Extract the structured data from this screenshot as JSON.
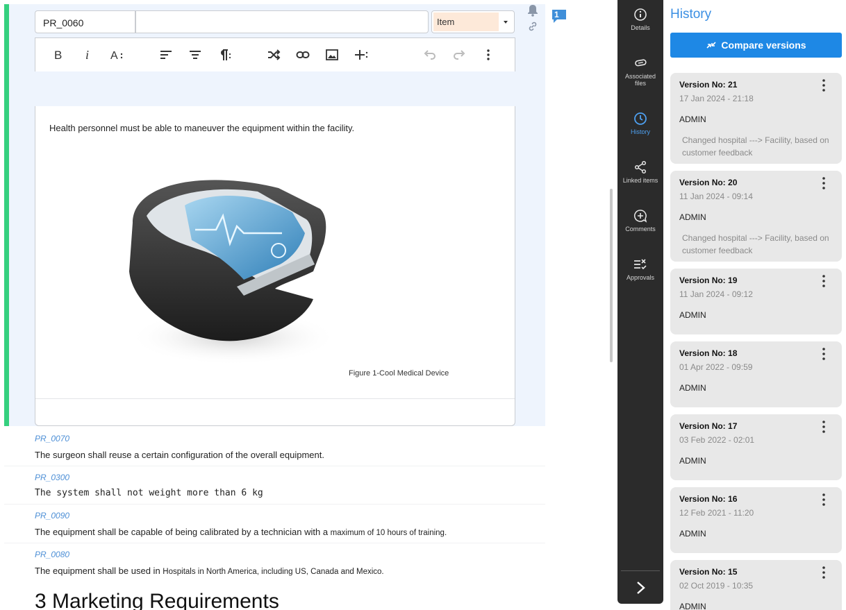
{
  "editor": {
    "item_id": "PR_0060",
    "item_title": "",
    "item_type": "Item",
    "comment_count": "1",
    "body_text": "Health personnel must be able to maneuver the equipment within the facility.",
    "figure_caption": "Figure 1-Cool Medical Device"
  },
  "requirements": [
    {
      "id": "PR_0070",
      "text": "The surgeon shall  reuse a certain configuration of the overall equipment."
    },
    {
      "id": "PR_0300",
      "text": "The system shall not weight more than 6 kg"
    },
    {
      "id": "PR_0090",
      "text": "The equipment shall be capable of being calibrated by a technician with a ",
      "text_small": "maximum of 10 hours of training."
    },
    {
      "id": "PR_0080",
      "text": "The equipment shall be used in ",
      "text_small": "Hospitals in North America, including US, Canada and Mexico."
    }
  ],
  "section_heading": "3  Marketing Requirements",
  "rail": {
    "details": "Details",
    "associated_files_1": "Associated",
    "associated_files_2": "files",
    "history": "History",
    "linked_items": "Linked items",
    "comments": "Comments",
    "approvals": "Approvals"
  },
  "history": {
    "title": "History",
    "compare_label": "Compare versions",
    "versions": [
      {
        "label": "Version No: 21",
        "date": "17 Jan 2024 - 21:18",
        "user": "ADMIN",
        "note": "Changed hospital ---> Facility, based on customer feedback"
      },
      {
        "label": "Version No: 20",
        "date": "11 Jan 2024 - 09:14",
        "user": "ADMIN",
        "note": "Changed hospital ---> Facility, based on customer feedback"
      },
      {
        "label": "Version No: 19",
        "date": "11 Jan 2024 - 09:12",
        "user": "ADMIN"
      },
      {
        "label": "Version No: 18",
        "date": "01 Apr 2022 - 09:59",
        "user": "ADMIN"
      },
      {
        "label": "Version No: 17",
        "date": "03 Feb 2022 - 02:01",
        "user": "ADMIN"
      },
      {
        "label": "Version No: 16",
        "date": "12 Feb 2021 - 11:20",
        "user": "ADMIN"
      },
      {
        "label": "Version No: 15",
        "date": "02 Oct 2019 - 10:35",
        "user": "ADMIN"
      }
    ]
  },
  "colors": {
    "accent": "#1e88e5",
    "active_rail": "#4ea0f0",
    "edit_marker": "#35d07f",
    "rail_bg": "#2b2b2b",
    "requirement_id": "#4d8fd6"
  }
}
